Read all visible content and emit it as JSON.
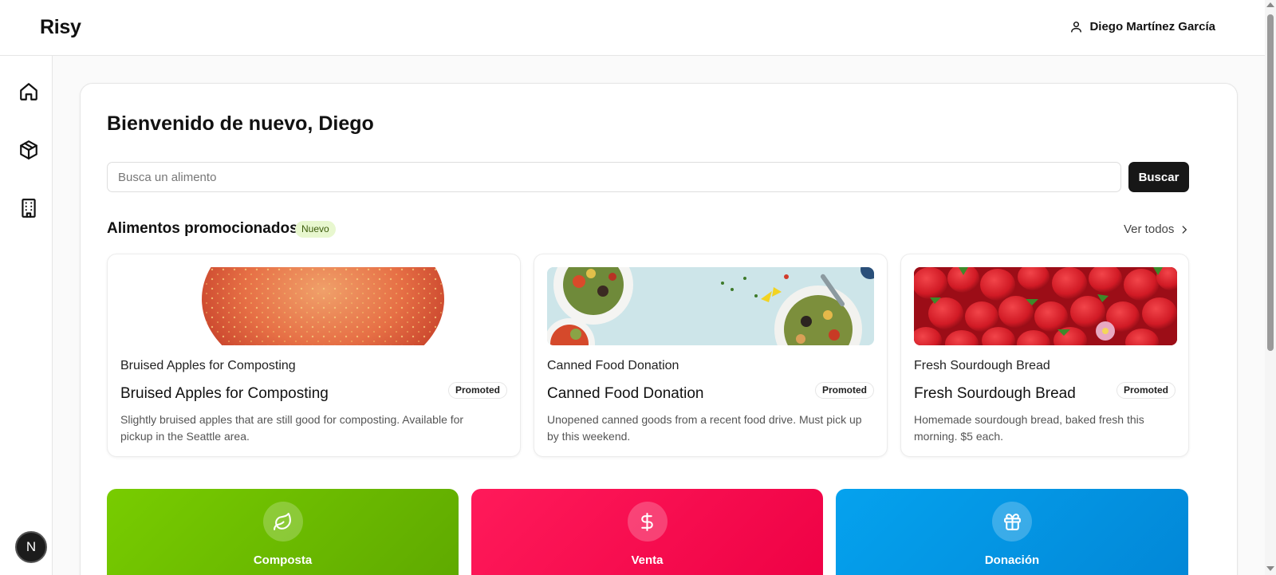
{
  "app": {
    "logo": "Risy"
  },
  "user": {
    "name": "Diego Martínez García"
  },
  "sidebar": {
    "items": [
      {
        "name": "home"
      },
      {
        "name": "products"
      },
      {
        "name": "organizations"
      }
    ],
    "badge": "N"
  },
  "main": {
    "welcome": "Bienvenido de nuevo, Diego",
    "search": {
      "placeholder": "Busca un alimento",
      "value": "",
      "button": "Buscar"
    },
    "promoted": {
      "title": "Alimentos promocionados",
      "badge": "Nuevo",
      "see_all": "Ver todos",
      "items": [
        {
          "subtitle": "Bruised Apples for Composting",
          "title": "Bruised Apples for Composting",
          "badge": "Promoted",
          "description_line1": "Slightly bruised apples that are still good for composting. Available for",
          "description_line2": "pickup in the Seattle area."
        },
        {
          "subtitle": "Canned Food Donation",
          "title": "Canned Food Donation",
          "badge": "Promoted",
          "description_line1": "Unopened canned goods from a recent food drive. Must pick up",
          "description_line2": "by this weekend."
        },
        {
          "subtitle": "Fresh Sourdough Bread",
          "title": "Fresh Sourdough Bread",
          "badge": "Promoted",
          "description_line1": "Homemade sourdough bread, baked fresh this",
          "description_line2": "morning. $5 each."
        }
      ]
    },
    "actions": [
      {
        "label": "Composta",
        "icon": "leaf-icon",
        "color": "#6bb800"
      },
      {
        "label": "Venta",
        "icon": "dollar-icon",
        "color": "#f2044f"
      },
      {
        "label": "Donación",
        "icon": "gift-icon",
        "color": "#0392e0"
      }
    ]
  }
}
